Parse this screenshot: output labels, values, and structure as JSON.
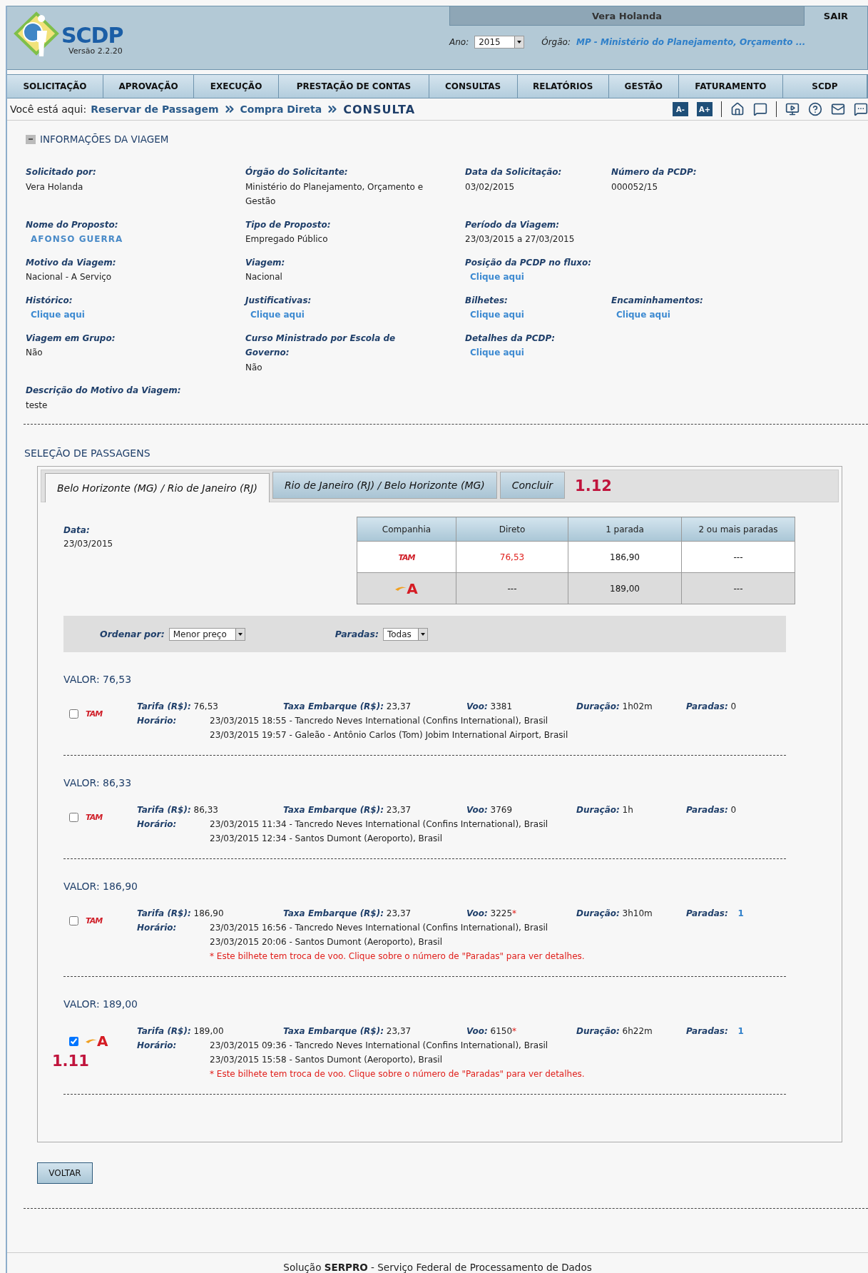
{
  "header": {
    "logo_text": "SCDP",
    "version": "Versão 2.2.20",
    "user": "Vera Holanda",
    "logout": "SAIR",
    "year_label": "Ano:",
    "year": "2015",
    "org_label": "Órgão:",
    "org": "MP - Ministério do Planejamento, Orçamento ..."
  },
  "nav": [
    "SOLICITAÇÃO",
    "APROVAÇÃO",
    "EXECUÇÃO",
    "PRESTAÇÃO DE CONTAS",
    "CONSULTAS",
    "RELATÓRIOS",
    "GESTÃO",
    "FATURAMENTO",
    "SCDP"
  ],
  "breadcrumb": {
    "label": "Você está aqui:",
    "links": [
      "Reservar de Passagem",
      "Compra Direta"
    ],
    "current": "CONSULTA",
    "font_buttons": [
      "A-",
      "A+"
    ]
  },
  "info": {
    "title": "INFORMAÇÕES DA VIAGEM",
    "rows": [
      [
        {
          "label": "Solicitado por:",
          "value": "Vera Holanda",
          "kind": "text"
        },
        {
          "label": "Órgão do Solicitante:",
          "value": "Ministério do Planejamento, Orçamento e Gestão",
          "kind": "text"
        },
        {
          "label": "Data da Solicitação:",
          "value": "03/02/2015",
          "kind": "text"
        },
        {
          "label": "Número da PCDP:",
          "value": "000052/15",
          "kind": "text"
        }
      ],
      [
        {
          "label": "Nome do Proposto:",
          "value": "AFONSO GUERRA",
          "kind": "name"
        },
        {
          "label": "Tipo de Proposto:",
          "value": "Empregado Público",
          "kind": "text"
        },
        {
          "label": "Período da Viagem:",
          "value": "23/03/2015 a 27/03/2015",
          "kind": "text"
        }
      ],
      [
        {
          "label": "Motivo da Viagem:",
          "value": "Nacional - A Serviço",
          "kind": "text"
        },
        {
          "label": "Viagem:",
          "value": "Nacional",
          "kind": "text"
        },
        {
          "label": "Posição da PCDP no fluxo:",
          "value": "Clique aqui",
          "kind": "link"
        }
      ],
      [
        {
          "label": "Histórico:",
          "value": "Clique aqui",
          "kind": "link"
        },
        {
          "label": "Justificativas:",
          "value": "Clique aqui",
          "kind": "link"
        },
        {
          "label": "Bilhetes:",
          "value": "Clique aqui",
          "kind": "link"
        },
        {
          "label": "Encaminhamentos:",
          "value": "Clique aqui",
          "kind": "link"
        }
      ],
      [
        {
          "label": "Viagem em Grupo:",
          "value": "Não",
          "kind": "text"
        },
        {
          "label": "Curso Ministrado por Escola de Governo:",
          "value": "Não",
          "kind": "text"
        },
        {
          "label": "Detalhes da PCDP:",
          "value": "Clique aqui",
          "kind": "link"
        }
      ],
      [
        {
          "label": "Descrição do Motivo da Viagem:",
          "value": "teste",
          "kind": "text"
        }
      ]
    ]
  },
  "selection": {
    "title": "SELEÇÃO DE PASSAGENS",
    "tabs": [
      {
        "label": "Belo Horizonte (MG) / Rio de Janeiro (RJ)",
        "selected": true
      },
      {
        "label": "Rio de Janeiro (RJ) / Belo Horizonte (MG)",
        "selected": false
      },
      {
        "label": "Concluir",
        "selected": false
      }
    ],
    "tabs_annotation": "1.12",
    "date_label": "Data:",
    "date": "23/03/2015",
    "summary": {
      "columns": [
        "Companhia",
        "Direto",
        "1 parada",
        "2 ou mais paradas"
      ],
      "rows": [
        {
          "cells": [
            {
              "kind": "airline",
              "airline": {
                "kind": "tam",
                "logo": "TAM"
              }
            },
            {
              "kind": "price",
              "text": "76,53",
              "highlight": true
            },
            {
              "kind": "price",
              "text": "186,90",
              "highlight": false
            },
            {
              "kind": "price",
              "text": "---",
              "highlight": false
            }
          ]
        },
        {
          "cells": [
            {
              "kind": "airline",
              "airline": {
                "kind": "avianca",
                "logo": "A"
              }
            },
            {
              "kind": "price",
              "text": "---",
              "highlight": false
            },
            {
              "kind": "price",
              "text": "189,00",
              "highlight": false
            },
            {
              "kind": "price",
              "text": "---",
              "highlight": false
            }
          ]
        }
      ]
    },
    "filters": {
      "sort_label": "Ordenar por:",
      "sort_value": "Menor preço",
      "stops_label": "Paradas:",
      "stops_value": "Todas"
    },
    "flights": [
      {
        "price": "VALOR: 76,53",
        "checked": false,
        "airline": {
          "kind": "tam",
          "logo": "TAM"
        },
        "details": [
          {
            "label": "Tarifa (R$):",
            "value": "76,53",
            "kind": "text"
          },
          {
            "label": "Taxa Embarque (R$):",
            "value": "23,37",
            "kind": "text"
          },
          {
            "label": "Voo:",
            "value": "3381",
            "kind": "text"
          },
          {
            "label": "Duração:",
            "value": "1h02m",
            "kind": "text"
          },
          {
            "label": "Paradas:",
            "value": "0",
            "kind": "text"
          }
        ],
        "schedule_label": "Horário:",
        "legs": [
          "23/03/2015 18:55 - Tancredo Neves International (Confins International), Brasil",
          "23/03/2015 19:57 - Galeão - Antônio Carlos (Tom) Jobim International Airport, Brasil"
        ]
      },
      {
        "price": "VALOR: 86,33",
        "checked": false,
        "airline": {
          "kind": "tam",
          "logo": "TAM"
        },
        "details": [
          {
            "label": "Tarifa (R$):",
            "value": "86,33",
            "kind": "text"
          },
          {
            "label": "Taxa Embarque (R$):",
            "value": "23,37",
            "kind": "text"
          },
          {
            "label": "Voo:",
            "value": "3769",
            "kind": "text"
          },
          {
            "label": "Duração:",
            "value": "1h",
            "kind": "text"
          },
          {
            "label": "Paradas:",
            "value": "0",
            "kind": "text"
          }
        ],
        "schedule_label": "Horário:",
        "legs": [
          "23/03/2015 11:34 - Tancredo Neves International (Confins International), Brasil",
          "23/03/2015 12:34 - Santos Dumont (Aeroporto), Brasil"
        ]
      },
      {
        "price": "VALOR: 186,90",
        "checked": false,
        "airline": {
          "kind": "tam",
          "logo": "TAM"
        },
        "details": [
          {
            "label": "Tarifa (R$):",
            "value": "186,90",
            "kind": "text"
          },
          {
            "label": "Taxa Embarque (R$):",
            "value": "23,37",
            "kind": "text"
          },
          {
            "label": "Voo:",
            "value": "3225",
            "mark": "*",
            "kind": "text"
          },
          {
            "label": "Duração:",
            "value": "3h10m",
            "kind": "text"
          },
          {
            "label": "Paradas:",
            "value": "1",
            "kind": "link"
          }
        ],
        "schedule_label": "Horário:",
        "legs": [
          "23/03/2015 16:56 - Tancredo Neves International (Confins International), Brasil",
          "23/03/2015 20:06 - Santos Dumont (Aeroporto), Brasil"
        ],
        "note": "* Este bilhete tem troca de voo. Clique sobre o número de \"Paradas\" para ver detalhes."
      },
      {
        "price": "VALOR: 189,00",
        "checked": true,
        "airline": {
          "kind": "avianca",
          "logo": "A"
        },
        "details": [
          {
            "label": "Tarifa (R$):",
            "value": "189,00",
            "kind": "text"
          },
          {
            "label": "Taxa Embarque (R$):",
            "value": "23,37",
            "kind": "text"
          },
          {
            "label": "Voo:",
            "value": "6150",
            "mark": "*",
            "kind": "text"
          },
          {
            "label": "Duração:",
            "value": "6h22m",
            "kind": "text"
          },
          {
            "label": "Paradas:",
            "value": "1",
            "kind": "link"
          }
        ],
        "schedule_label": "Horário:",
        "legs": [
          "23/03/2015 09:36 - Tancredo Neves International (Confins International), Brasil",
          "23/03/2015 15:58 - Santos Dumont (Aeroporto), Brasil"
        ],
        "note": "* Este bilhete tem troca de voo. Clique sobre o número de \"Paradas\" para ver detalhes.",
        "annotation": "1.11"
      }
    ]
  },
  "back_button": "VOLTAR",
  "footer": "Solução  **SERPRO**  - Serviço Federal de Processamento de Dados"
}
